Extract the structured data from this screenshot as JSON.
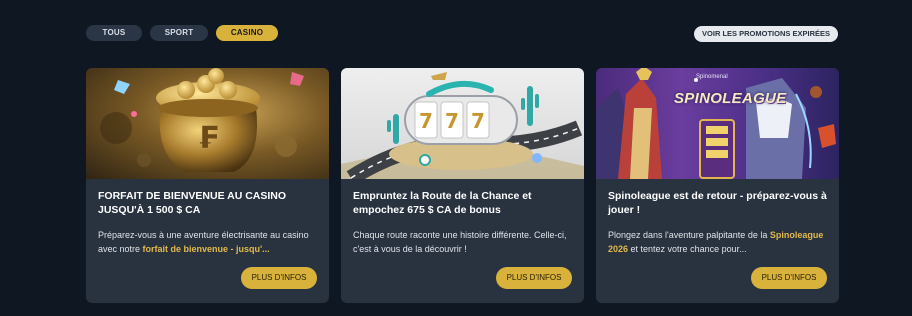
{
  "filters": {
    "tous": "TOUS",
    "sport": "SPORT",
    "casino": "CASINO",
    "active": "casino"
  },
  "expired_button": "VOIR LES PROMOTIONS EXPIRÉES",
  "colors": {
    "background": "#0f1723",
    "card": "#29323f",
    "accent": "#d9b23c",
    "highlight": "#e2b94a"
  },
  "cards": [
    {
      "image_icon": "gold-pot-image",
      "title": "FORFAIT DE BIENVENUE AU CASINO JUSQU'À 1 500 $ CA",
      "desc_before": "Préparez-vous à une aventure électrisante au casino avec notre ",
      "desc_highlight": "forfait de bienvenue - jusqu'...",
      "desc_after": "",
      "button": "PLUS D'INFOS"
    },
    {
      "image_icon": "route-slot-image",
      "title": "Empruntez la Route de la Chance et empochez 675 $ CA de bonus",
      "desc_before": "Chaque route raconte une histoire différente. Celle-ci, c'est à vous de la découvrir !",
      "desc_highlight": "",
      "desc_after": "",
      "button": "PLUS D'INFOS"
    },
    {
      "image_icon": "spinoleague-image",
      "brand_tag": "Spinomenal",
      "logo_text": "SPINOLEAGUE",
      "title": "Spinoleague est de retour - préparez-vous à jouer !",
      "desc_before": "Plongez dans l'aventure palpitante de la ",
      "desc_highlight": "Spinoleague 2026",
      "desc_after": " et tentez votre chance pour...",
      "button": "PLUS D'INFOS"
    }
  ]
}
